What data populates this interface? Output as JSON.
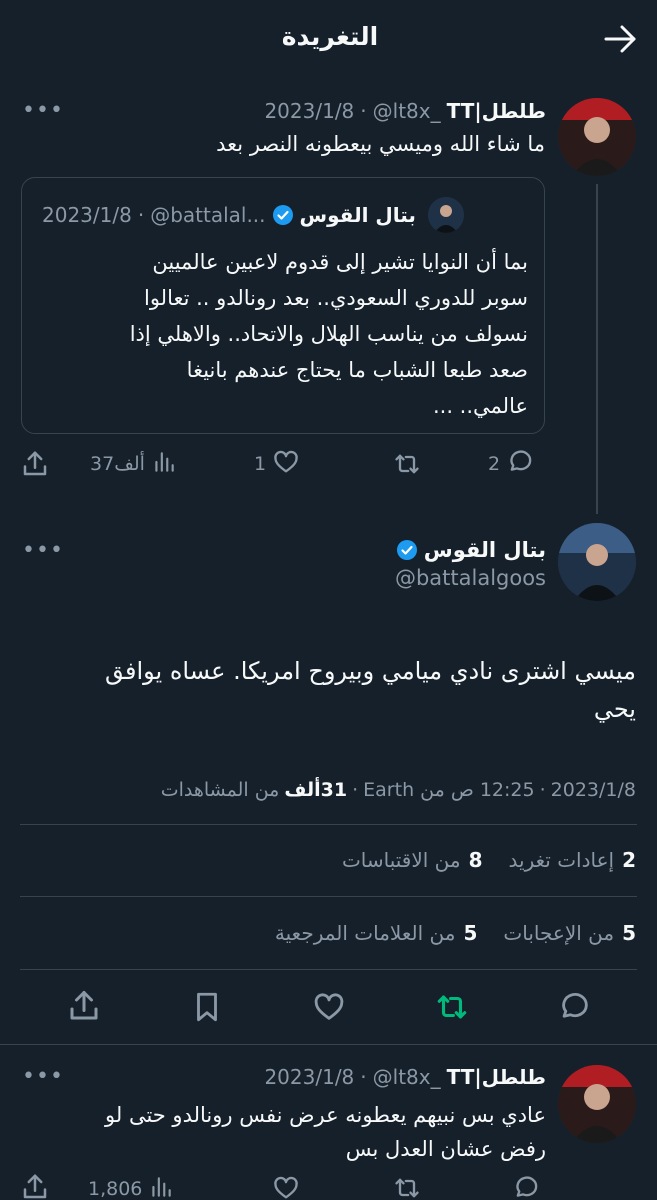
{
  "header": {
    "title": "التغريدة"
  },
  "reply1": {
    "author_name": "طلطل|TT",
    "handle": "@lt8x_",
    "date": "2023/1/8",
    "text": "ما شاء الله وميسي بيعطونه النصر بعد",
    "quote": {
      "author_name": "بتال القوس",
      "handle": "@battalal...",
      "date": "2023/1/8",
      "lines": [
        "بما أن النوايا تشير إلى قدوم لاعبين عالميين",
        "سوبر للدوري السعودي.. بعد رونالدو .. تعالوا",
        "نسولف من يناسب الهلال والاتحاد.. والاهلي إذا",
        "صعد طبعا الشباب ما يحتاج عندهم بانيغا",
        "عالمي.. ..."
      ]
    },
    "actions": {
      "replies": "2",
      "likes": "1",
      "views": "37ألف"
    }
  },
  "main": {
    "author_name": "بتال القوس",
    "handle": "@battalalgoos",
    "text_lines": [
      "ميسي اشترى نادي ميامي وبيروح امريكا. عساه يوافق",
      "يحي"
    ],
    "meta": {
      "date": "2023/1/8",
      "sep1": "·",
      "time_source": "12:25 ص من Earth",
      "sep2": "·",
      "views_value": "31ألف",
      "views_label": "من المشاهدات"
    },
    "stats1": {
      "retweets_count": "2",
      "retweets_label": "إعادات تغريد",
      "quotes_count": "8",
      "quotes_label": "من الاقتباسات"
    },
    "stats2": {
      "likes_count": "5",
      "likes_label": "من الإعجابات",
      "bookmarks_count": "5",
      "bookmarks_label": "من العلامات المرجعية"
    }
  },
  "reply2": {
    "author_name": "طلطل|TT",
    "handle": "@lt8x_",
    "date": "2023/1/8",
    "lines": [
      "عادي بس نبيهم يعطونه عرض نفس رونالدو حتى لو",
      "رفض عشان العدل بس"
    ],
    "actions": {
      "views": "1,806"
    }
  },
  "colors": {
    "background": "#15202b",
    "text": "#f7f9f9",
    "muted": "#8b98a5",
    "border": "#38444d",
    "retweet_active": "#00ba7c",
    "verified": "#1d9bf0"
  },
  "icons": [
    "back-arrow-icon",
    "more-icon",
    "verified-icon",
    "reply-icon",
    "retweet-icon",
    "like-icon",
    "views-icon",
    "share-icon",
    "bookmark-icon"
  ]
}
